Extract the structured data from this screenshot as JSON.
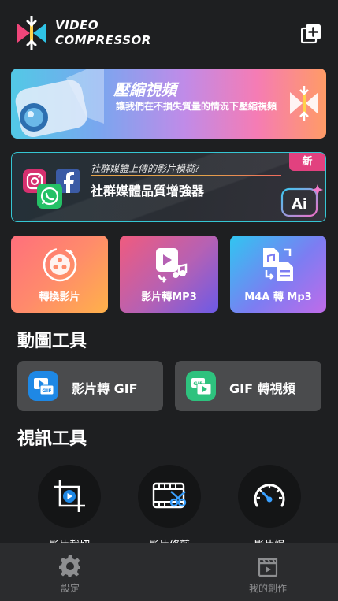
{
  "header": {
    "brand_line1": "VIDEO",
    "brand_line2": "COMPRESSOR",
    "add_icon": "add-square-icon"
  },
  "banner_compress": {
    "title": "壓縮視頻",
    "subtitle": "讓我們在不損失質量的情況下壓縮視頻",
    "icon": "compress-arrows-icon"
  },
  "banner_enhance": {
    "badge": "新",
    "tagline": "社群媒體上傳的影片模糊?",
    "title": "社群媒體品質增強器",
    "icons": [
      "instagram-icon",
      "facebook-icon",
      "whatsapp-icon",
      "ai-icon"
    ]
  },
  "feature_cards": [
    {
      "label": "轉換影片",
      "icon": "film-reel-icon"
    },
    {
      "label": "影片轉MP3",
      "icon": "video-to-music-icon"
    },
    {
      "label": "M4A 轉 Mp3",
      "icon": "audio-file-convert-icon"
    }
  ],
  "gif_tools": {
    "title": "動圖工具",
    "items": [
      {
        "label": "影片轉 GIF",
        "icon": "video-to-gif-icon",
        "color": "#1e88e5"
      },
      {
        "label": "GIF 轉視頻",
        "icon": "gif-to-video-icon",
        "color": "#2ec27e"
      }
    ]
  },
  "video_tools": {
    "title": "視訊工具",
    "items": [
      {
        "label": "影片裁切",
        "icon": "crop-video-icon"
      },
      {
        "label": "影片修剪",
        "icon": "trim-video-icon"
      },
      {
        "label": "影片慢",
        "icon": "speed-gauge-icon"
      }
    ]
  },
  "bottom_nav": [
    {
      "label": "設定",
      "icon": "gear-icon"
    },
    {
      "label": "我的創作",
      "icon": "clapperboard-icon"
    }
  ],
  "colors": {
    "background": "#1e1f21",
    "accent_cyan": "#35c6d3",
    "badge_pink": "#e2417f"
  }
}
